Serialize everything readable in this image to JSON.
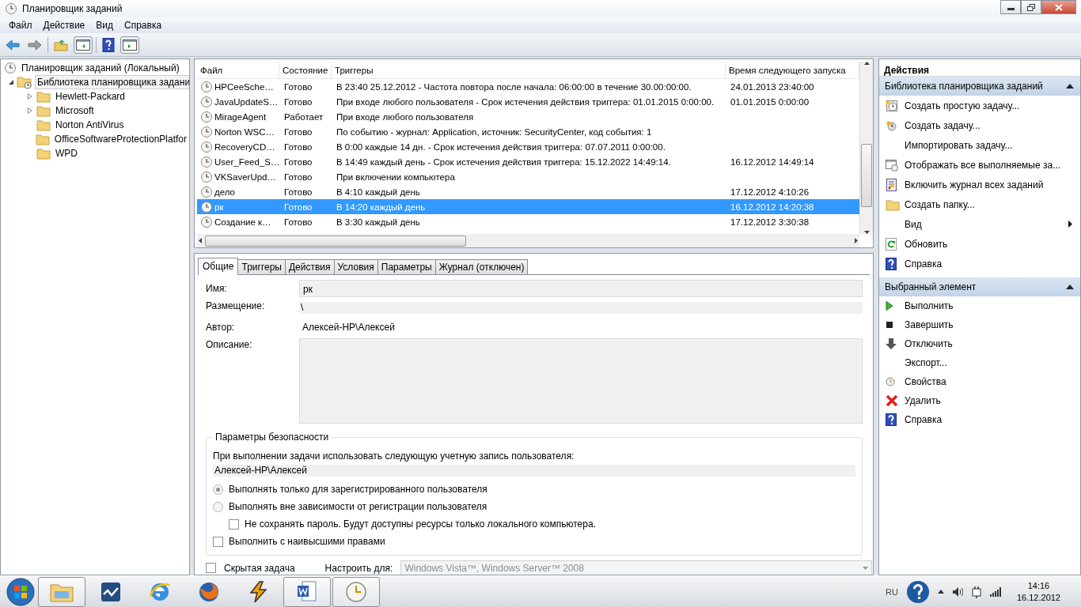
{
  "window": {
    "title": "Планировщик заданий"
  },
  "menu": [
    "Файл",
    "Действие",
    "Вид",
    "Справка"
  ],
  "tree": {
    "items": [
      {
        "label": "Планировщик заданий (Локальный)",
        "selected": false,
        "children": [
          {
            "label": "Библиотека планировщика задани",
            "selected": true,
            "expanded": true,
            "children": [
              {
                "label": "Hewlett-Packard",
                "selected": false,
                "expanded": false
              },
              {
                "label": "Microsoft",
                "selected": false,
                "expanded": false
              },
              {
                "label": "Norton AntiVirus",
                "selected": false
              },
              {
                "label": "OfficeSoftwareProtectionPlatfor",
                "selected": false
              },
              {
                "label": "WPD",
                "selected": false
              }
            ]
          }
        ]
      }
    ]
  },
  "table": {
    "columns": [
      "Файл",
      "Состояние",
      "Триггеры",
      "Время следующего запуска"
    ],
    "rows": [
      {
        "cells": [
          "HPCeeSche…",
          "Готово",
          "В 23:40 25.12.2012 - Частота повтора после начала: 06:00:00 в течение 30.00:00:00.",
          "24.01.2013 23:40:00"
        ],
        "selected": false
      },
      {
        "cells": [
          "JavaUpdateS…",
          "Готово",
          "При входе любого пользователя - Срок истечения действия триггера: 01.01.2015 0:00:00.",
          "01.01.2015 0:00:00"
        ],
        "selected": false
      },
      {
        "cells": [
          "MirageAgent",
          "Работает",
          "При входе любого пользователя",
          ""
        ],
        "selected": false
      },
      {
        "cells": [
          "Norton WSC…",
          "Готово",
          "По событию - журнал: Application, источник: SecurityCenter, код события: 1",
          ""
        ],
        "selected": false
      },
      {
        "cells": [
          "RecoveryCD…",
          "Готово",
          "В 0:00 каждые 14 дн. - Срок истечения действия триггера: 07.07.2011 0:00:00.",
          ""
        ],
        "selected": false
      },
      {
        "cells": [
          "User_Feed_S…",
          "Готово",
          "В 14:49 каждый день - Срок истечения действия триггера: 15.12.2022 14:49:14.",
          "16.12.2012 14:49:14"
        ],
        "selected": false
      },
      {
        "cells": [
          "VKSaverUpd…",
          "Готово",
          "При включении компьютера",
          ""
        ],
        "selected": false
      },
      {
        "cells": [
          "дело",
          "Готово",
          "В 4:10 каждый день",
          "17.12.2012 4:10:26"
        ],
        "selected": false
      },
      {
        "cells": [
          "рк",
          "Готово",
          "В 14:20 каждый день",
          "16.12.2012 14:20:38"
        ],
        "selected": true
      },
      {
        "cells": [
          "Создание к…",
          "Готово",
          "В 3:30 каждый день",
          "17.12.2012 3:30:38"
        ],
        "selected": false
      }
    ]
  },
  "tabs": [
    {
      "label": "Общие",
      "selected": true
    },
    {
      "label": "Триггеры",
      "selected": false
    },
    {
      "label": "Действия",
      "selected": false
    },
    {
      "label": "Условия",
      "selected": false
    },
    {
      "label": "Параметры",
      "selected": false
    },
    {
      "label": "Журнал (отключен)",
      "selected": false
    }
  ],
  "general": {
    "fields": [
      {
        "kind": "input",
        "label": "Имя:",
        "value": "рк"
      },
      {
        "kind": "readonly",
        "label": "Размещение:",
        "value": "\\"
      },
      {
        "kind": "text",
        "label": "Автор:",
        "value": "Алексей-HP\\Алексей"
      },
      {
        "kind": "textarea",
        "label": "Описание:"
      }
    ],
    "security": {
      "title": "Параметры безопасности",
      "prompt": "При выполнении задачи использовать следующую учетную запись пользователя:",
      "account": "Алексей-HP\\Алексей",
      "options": [
        {
          "kind": "radio",
          "label": "Выполнять только для зарегистрированного пользователя",
          "selected": true
        },
        {
          "kind": "radio",
          "label": "Выполнять вне зависимости от регистрации пользователя",
          "selected": false,
          "children": [
            {
              "kind": "checkbox",
              "label": "Не сохранять пароль. Будут доступны ресурсы только локального компьютера.",
              "checked": false
            }
          ]
        },
        {
          "kind": "checkbox",
          "label": "Выполнить с наивысшими правами",
          "checked": false
        }
      ]
    },
    "hidden": {
      "label": "Скрытая задача",
      "checked": false
    },
    "configure": {
      "label": "Настроить для:",
      "value": "Windows Vista™, Windows Server™ 2008",
      "disabled": true
    }
  },
  "actions": {
    "title": "Действия",
    "sections": [
      {
        "title": "Библиотека планировщика заданий",
        "expanded": true,
        "items": [
          {
            "kind": "simple-task",
            "label": "Создать простую задачу..."
          },
          {
            "kind": "task",
            "label": "Создать задачу..."
          },
          {
            "kind": "plain",
            "label": "Импортировать задачу..."
          },
          {
            "kind": "running",
            "label": "Отображать все выполняемые за..."
          },
          {
            "kind": "log",
            "label": "Включить журнал всех заданий"
          },
          {
            "kind": "folder",
            "label": "Создать папку..."
          },
          {
            "kind": "submenu",
            "label": "Вид"
          },
          {
            "kind": "refresh",
            "label": "Обновить"
          },
          {
            "kind": "help",
            "label": "Справка"
          }
        ]
      },
      {
        "title": "Выбранный элемент",
        "expanded": true,
        "items": [
          {
            "kind": "run",
            "label": "Выполнить"
          },
          {
            "kind": "stop",
            "label": "Завершить"
          },
          {
            "kind": "disable",
            "label": "Отключить"
          },
          {
            "kind": "plain",
            "label": "Экспорт..."
          },
          {
            "kind": "properties",
            "label": "Свойства"
          },
          {
            "kind": "delete",
            "label": "Удалить"
          },
          {
            "kind": "help",
            "label": "Справка"
          }
        ]
      }
    ]
  },
  "taskbar": {
    "apps": [
      {
        "kind": "explorer",
        "open": true
      },
      {
        "kind": "chart",
        "open": false
      },
      {
        "kind": "browser-e",
        "open": false
      },
      {
        "kind": "browser-fox",
        "open": false
      },
      {
        "kind": "player",
        "open": false
      },
      {
        "kind": "word",
        "open": true
      },
      {
        "kind": "clock",
        "open": true
      }
    ],
    "language": "RU",
    "time": "14:16",
    "date": "16.12.2012"
  }
}
